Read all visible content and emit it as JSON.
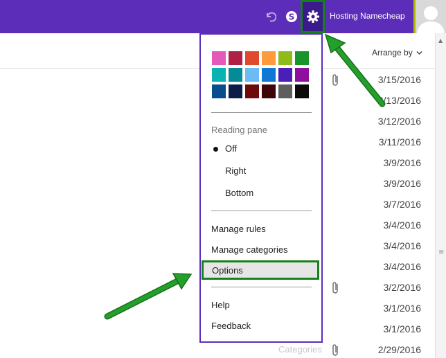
{
  "header": {
    "account_name": "Hosting Namecheap",
    "icons": [
      "undo-icon",
      "skype-icon",
      "gear-icon",
      "avatar-icon"
    ],
    "background_color": "#5c2db8",
    "highlight_color": "#16801c"
  },
  "toolbar": {
    "arrange_label": "Arrange by"
  },
  "messages": {
    "dates": [
      "3/15/2016",
      "3/13/2016",
      "3/12/2016",
      "3/11/2016",
      "3/9/2016",
      "3/9/2016",
      "3/7/2016",
      "3/4/2016",
      "3/4/2016",
      "3/4/2016",
      "3/2/2016",
      "3/1/2016",
      "3/1/2016",
      "2/29/2016"
    ],
    "categories_label": "Categories"
  },
  "settings_menu": {
    "theme_colors": [
      "#e35ab8",
      "#b01f45",
      "#e0492b",
      "#ff9a3c",
      "#8fbb1a",
      "#17952b",
      "#0bb2b2",
      "#058b96",
      "#6dbbf5",
      "#0f78d4",
      "#4a1fb8",
      "#8e0e9e",
      "#0a4d8c",
      "#0c1e47",
      "#6e0a0a",
      "#3d0508",
      "#5e5e5e",
      "#0a0a0a"
    ],
    "reading_pane": {
      "label": "Reading pane",
      "options": [
        "Off",
        "Right",
        "Bottom"
      ],
      "selected": "Off"
    },
    "items": {
      "manage_rules": "Manage rules",
      "manage_categories": "Manage categories",
      "options": "Options",
      "help": "Help",
      "feedback": "Feedback"
    }
  }
}
